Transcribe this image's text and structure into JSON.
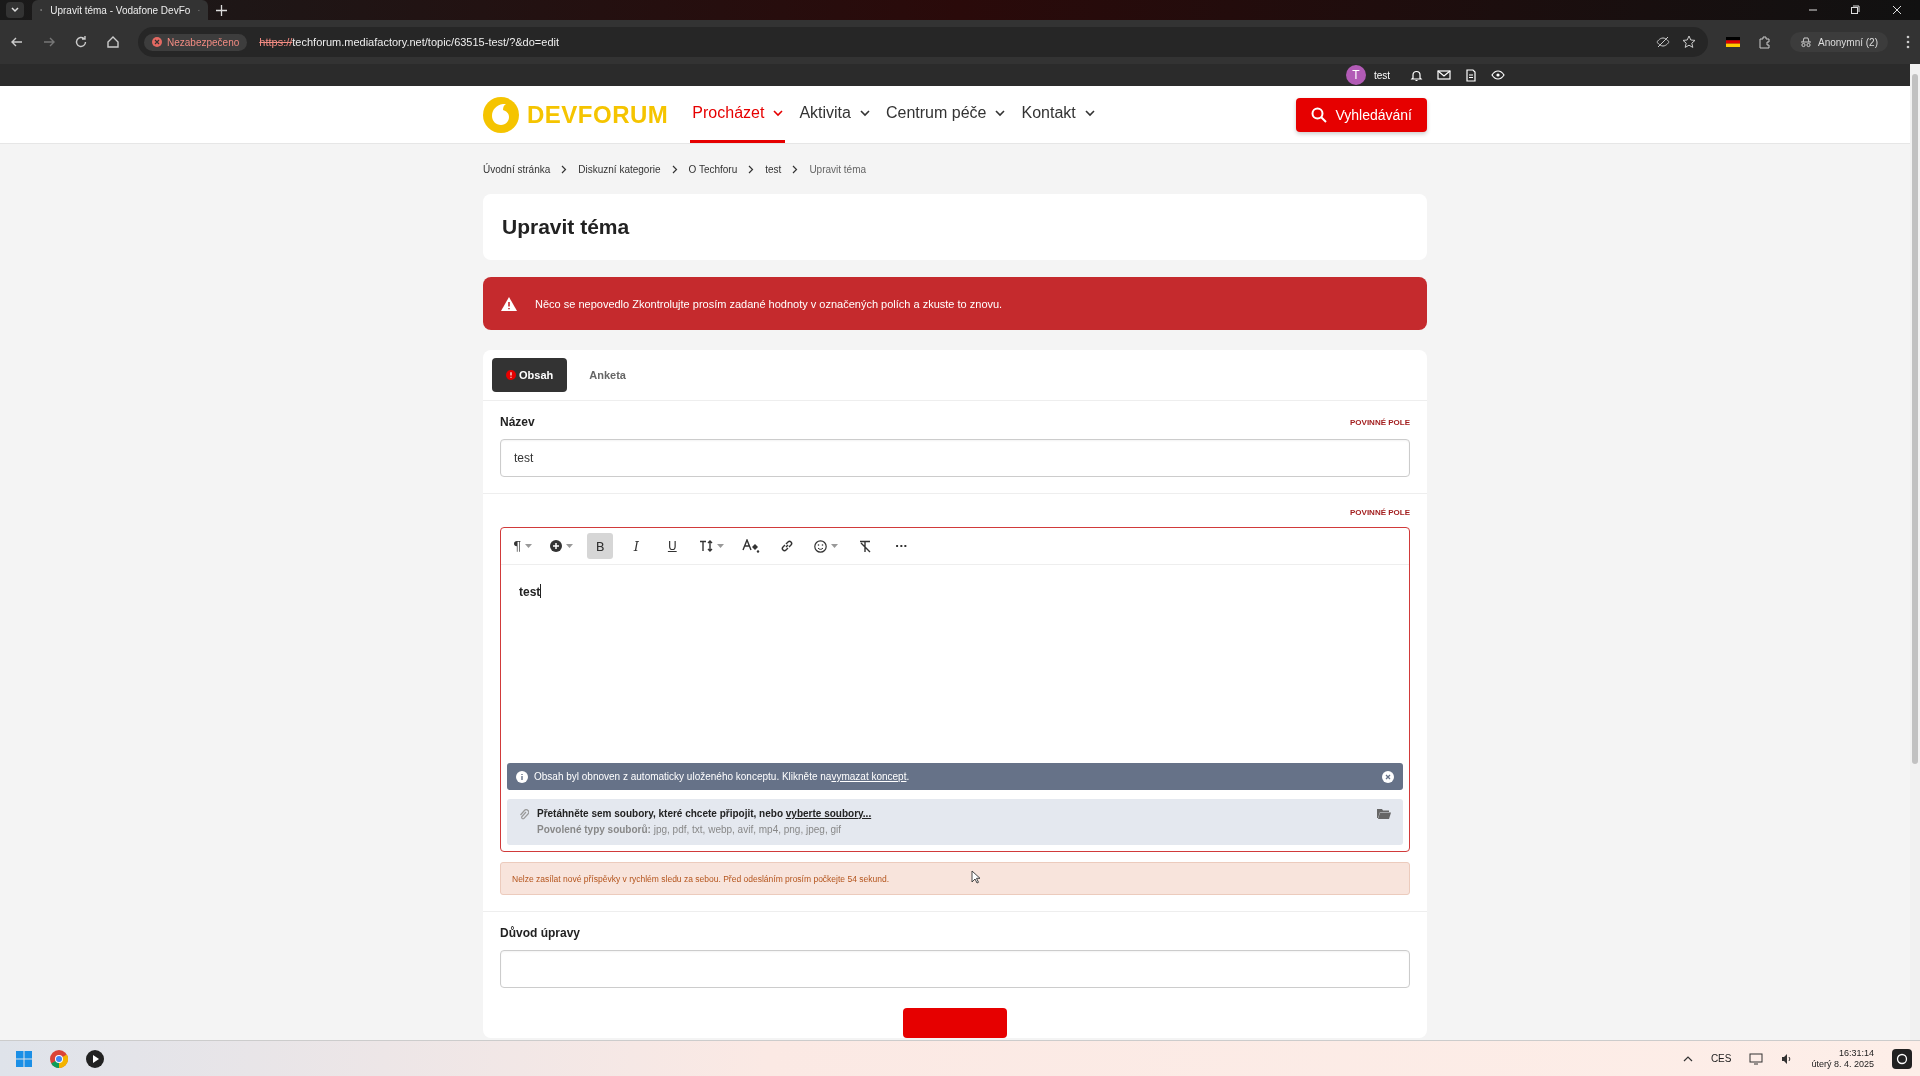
{
  "browser": {
    "tab_title": "Upravit téma - Vodafone DevFo",
    "security": "Nezabezpečeno",
    "url_scheme": "https://",
    "url_rest": "techforum.mediafactory.net/topic/63515-test/?&do=edit",
    "profile": "Anonymní (2)"
  },
  "userbar": {
    "avatar_letter": "T",
    "username": "test"
  },
  "header": {
    "logo": "DEVFORUM",
    "nav": [
      {
        "label": "Procházet",
        "selected": true
      },
      {
        "label": "Aktivita",
        "selected": false
      },
      {
        "label": "Centrum péče",
        "selected": false
      },
      {
        "label": "Kontakt",
        "selected": false
      }
    ],
    "search_button": "Vyhledávání"
  },
  "breadcrumb": [
    "Úvodní stránka",
    "Diskuzní kategorie",
    "O Techforu",
    "test",
    "Upravit téma"
  ],
  "page_title": "Upravit téma",
  "error_alert": "Něco se nepovedlo Zkontrolujte prosím zadané hodnoty v označených polích a zkuste to znovu.",
  "tabs": [
    {
      "label": "Obsah",
      "selected": true,
      "error": true
    },
    {
      "label": "Anketa",
      "selected": false,
      "error": false
    }
  ],
  "title_field": {
    "label": "Název",
    "required": "POVINNÉ POLE",
    "value": "test"
  },
  "editor": {
    "required": "POVINNÉ POLE",
    "invalid": true,
    "toolbar": [
      {
        "kind": "paragraph",
        "glyph": "¶",
        "dropdown": true,
        "active": false
      },
      {
        "kind": "insert",
        "dropdown": true,
        "active": false
      },
      {
        "kind": "bold",
        "glyph": "B",
        "dropdown": false,
        "active": true
      },
      {
        "kind": "italic",
        "glyph": "I",
        "dropdown": false,
        "active": false
      },
      {
        "kind": "underline",
        "glyph": "U",
        "dropdown": false,
        "active": false
      },
      {
        "kind": "size",
        "dropdown": true,
        "active": false
      },
      {
        "kind": "color",
        "dropdown": false,
        "active": false
      },
      {
        "kind": "link",
        "dropdown": false,
        "active": false
      },
      {
        "kind": "emoji",
        "dropdown": true,
        "active": false
      },
      {
        "kind": "clear",
        "dropdown": false,
        "active": false
      },
      {
        "kind": "more",
        "glyph": "···",
        "dropdown": false,
        "active": false
      }
    ],
    "content": "test",
    "draft_notice": {
      "text": "Obsah byl obnoven z automaticky uloženého konceptu. Klikněte na",
      "link": "vymazat koncept",
      "suffix": "."
    },
    "attach": {
      "text": "Přetáhněte sem soubory, které chcete připojit, nebo",
      "link": "vyberte soubory...",
      "types_label": "Povolené typy souborů:",
      "types": "jpg, pdf, txt, webp, avif, mp4, png, jpeg, gif"
    }
  },
  "flood_warning": "Nelze zasílat nové příspěvky v rychlém sledu za sebou. Před odesláním prosím počkejte 54 sekund.",
  "reason_field": {
    "label": "Důvod úpravy"
  },
  "taskbar": {
    "language": "CES",
    "time": "16:31:14",
    "date": "úterý 8. 4. 2025"
  }
}
